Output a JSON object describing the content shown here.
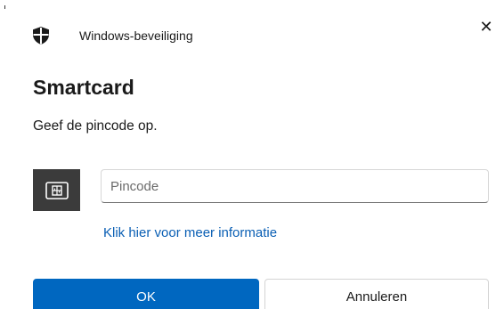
{
  "window": {
    "app_title": "Windows-beveiliging",
    "close_glyph": "✕"
  },
  "dialog": {
    "heading": "Smartcard",
    "instruction": "Geef de pincode op."
  },
  "pin_field": {
    "placeholder": "Pincode",
    "value": ""
  },
  "more_info_link": "Klik hier voor meer informatie",
  "buttons": {
    "ok_label": "OK",
    "cancel_label": "Annuleren"
  },
  "icons": {
    "shield": "shield-icon",
    "smartcard": "smartcard-icon"
  },
  "colors": {
    "accent": "#0067c0",
    "link": "#0a5fb4",
    "card_tile": "#3b3b3b"
  }
}
